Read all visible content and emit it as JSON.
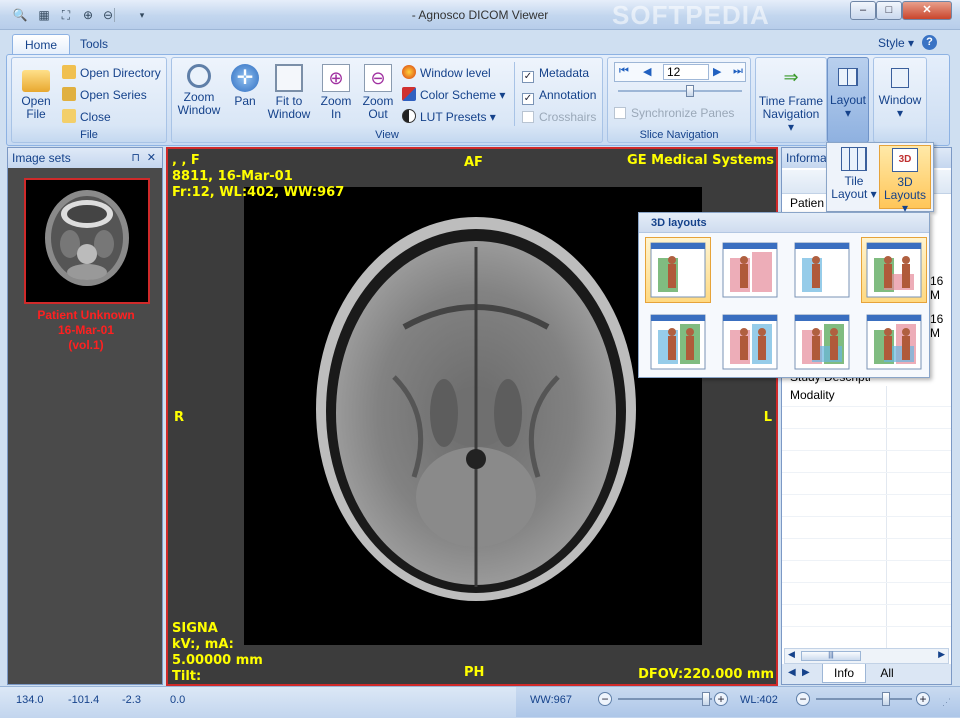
{
  "window": {
    "title": "- Agnosco DICOM Viewer",
    "watermark": "SOFTPEDIA",
    "minimize": "–",
    "maximize": "□",
    "close": "✕"
  },
  "quick_access": [
    "zoom-icon",
    "window-icon",
    "fit-icon",
    "zoom-in-icon",
    "zoom-out-icon",
    "dropdown-icon"
  ],
  "tabs": {
    "home": "Home",
    "tools": "Tools"
  },
  "style_menu": {
    "label": "Style ▾",
    "help": "?"
  },
  "file_group": {
    "label": "File",
    "open_file": [
      "Open",
      "File"
    ],
    "open_directory": "Open Directory",
    "open_series": "Open Series",
    "close": "Close"
  },
  "view_group": {
    "label": "View",
    "zoom_window": [
      "Zoom",
      "Window"
    ],
    "pan": "Pan",
    "fit_to_window": [
      "Fit to",
      "Window"
    ],
    "zoom_in": [
      "Zoom",
      "In"
    ],
    "zoom_out": [
      "Zoom",
      "Out"
    ],
    "window_level": "Window level",
    "color_scheme": "Color Scheme ▾",
    "lut_presets": "LUT Presets ▾",
    "metadata": "Metadata",
    "annotation": "Annotation",
    "crosshairs": "Crosshairs"
  },
  "slice_group": {
    "label": "Slice Navigation",
    "slice_value": "12",
    "synchronize": "Synchronize Panes"
  },
  "timeframe": {
    "label": [
      "Time Frame",
      "Navigation ▾"
    ]
  },
  "layout": {
    "label": "Layout",
    "arrow": "▾"
  },
  "window_btn": {
    "label": "Window",
    "arrow": "▾"
  },
  "layout_sub": {
    "tile": [
      "Tile",
      "Layout ▾"
    ],
    "three_d": [
      "3D",
      "Layouts ▾"
    ]
  },
  "image_sets": {
    "title": "Image sets",
    "pin": "⊓",
    "close": "✕",
    "patient": "Patient Unknown",
    "date": "16-Mar-01",
    "vol": "(vol.1)"
  },
  "overlay": {
    "top_left": [
      ", , F",
      "8811, 16-Mar-01",
      "Fr:12, WL:402, WW:967"
    ],
    "top_center": "AF",
    "top_right": "GE Medical Systems",
    "left": "R",
    "right": "L",
    "bottom_left": [
      "SIGNA",
      "kV:, mA:",
      "5.00000 mm",
      "Tilt:"
    ],
    "bottom_center": "PH",
    "bottom_right": "DFOV:220.000 mm"
  },
  "info_panel": {
    "title": "Informa",
    "patient_cell": "Patien",
    "row_16a": "16 M",
    "row_16b": "16 M",
    "study_desc": "Study Descripti",
    "modality": "Modality",
    "tabs": [
      "Info",
      "All"
    ],
    "scroll": "|||"
  },
  "popup": {
    "title": "3D layouts"
  },
  "status": {
    "x": "134.0",
    "y": "-101.4",
    "z": "-2.3",
    "val": "0.0",
    "ww": "WW:967",
    "wl": "WL:402"
  },
  "watermark_url": "www.softpedia.com",
  "colors": {
    "accent": "#15428b",
    "overlay": "#ffff00",
    "patient": "#ff2020",
    "frame": "#d02a2a"
  }
}
